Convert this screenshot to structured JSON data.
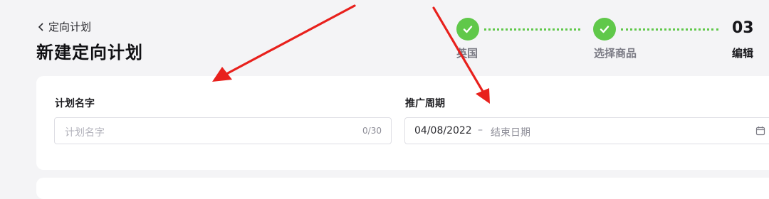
{
  "header": {
    "back_label": "定向计划",
    "title": "新建定向计划"
  },
  "steps": [
    {
      "number": "",
      "label": "英国",
      "state": "done"
    },
    {
      "number": "",
      "label": "选择商品",
      "state": "done"
    },
    {
      "number": "03",
      "label": "编辑",
      "state": "active"
    }
  ],
  "form": {
    "plan_name": {
      "label": "计划名字",
      "placeholder": "计划名字",
      "counter": "0/30"
    },
    "period": {
      "label": "推广周期",
      "start_date": "04/08/2022",
      "separator": "–",
      "end_placeholder": "结束日期"
    }
  },
  "colors": {
    "step_done": "#60c84a",
    "annotation_arrow": "#e8201c"
  }
}
